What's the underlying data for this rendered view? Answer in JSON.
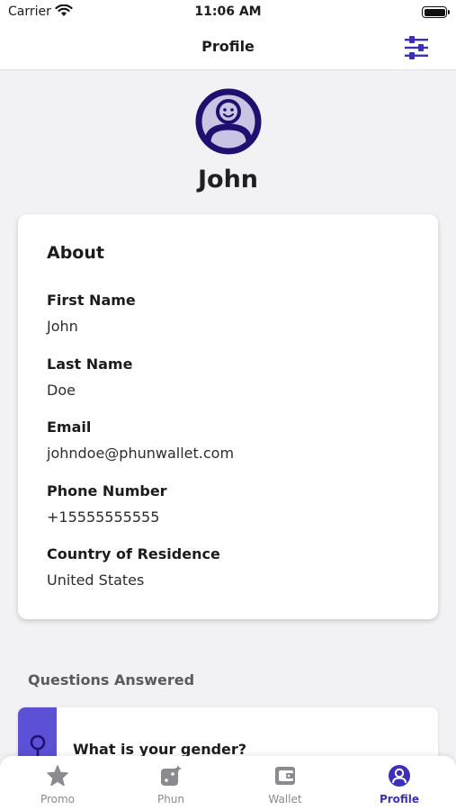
{
  "status_bar": {
    "carrier": "Carrier",
    "time": "11:06 AM"
  },
  "nav": {
    "title": "Profile",
    "settings_icon": "sliders-icon"
  },
  "profile": {
    "name": "John",
    "avatar_icon": "user-circle-icon"
  },
  "about": {
    "title": "About",
    "fields": [
      {
        "label": "First Name",
        "value": "John"
      },
      {
        "label": "Last Name",
        "value": "Doe"
      },
      {
        "label": "Email",
        "value": "johndoe@phunwallet.com"
      },
      {
        "label": "Phone Number",
        "value": "+15555555555"
      },
      {
        "label": "Country of Residence",
        "value": "United States"
      }
    ]
  },
  "questions": {
    "title": "Questions Answered",
    "items": [
      {
        "text": "What is your gender?"
      }
    ]
  },
  "tabs": [
    {
      "label": "Promo",
      "icon": "star-icon",
      "active": false
    },
    {
      "label": "Phun",
      "icon": "dice-icon",
      "active": false
    },
    {
      "label": "Wallet",
      "icon": "wallet-icon",
      "active": false
    },
    {
      "label": "Profile",
      "icon": "profile-icon",
      "active": true
    }
  ],
  "colors": {
    "accent": "#3c2fb8",
    "avatar_dark": "#1f0f6e",
    "avatar_light": "#c8c4e4",
    "tab_inactive": "#8a8a90"
  }
}
